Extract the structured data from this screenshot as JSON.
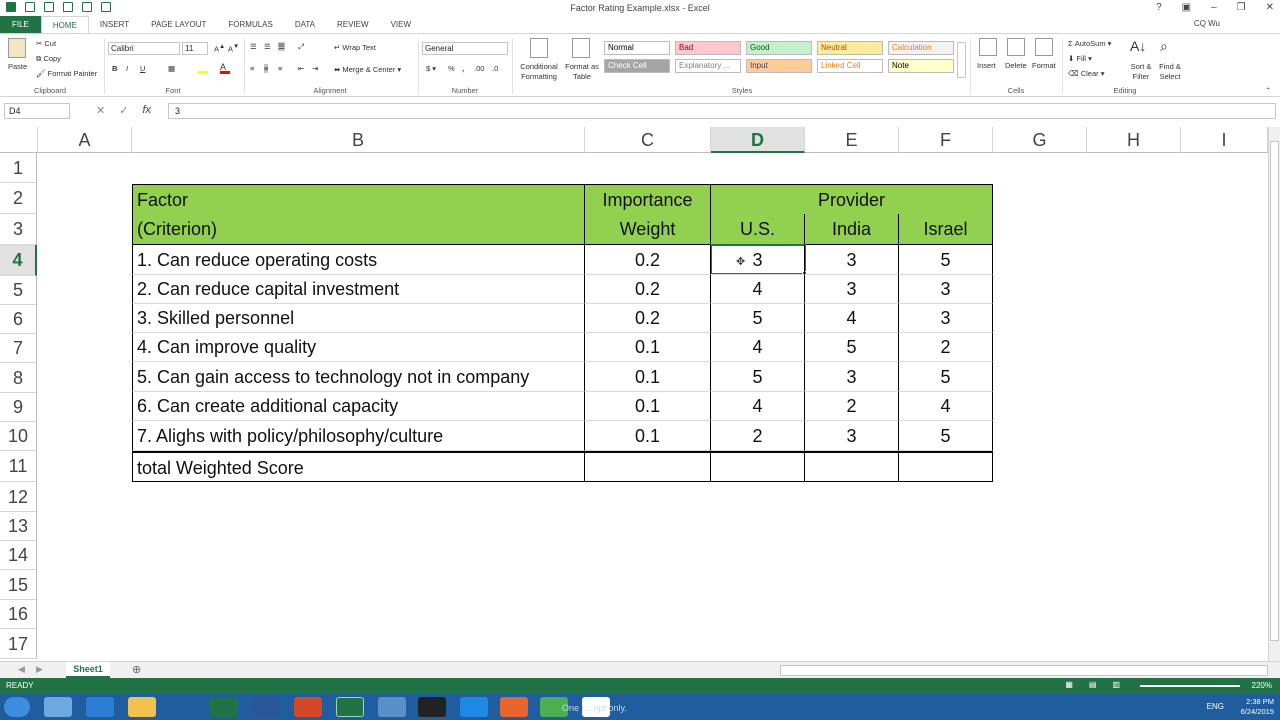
{
  "window": {
    "title": "Factor Rating Example.xlsx - Excel",
    "user": "CQ Wu"
  },
  "tabs": [
    "FILE",
    "HOME",
    "INSERT",
    "PAGE LAYOUT",
    "FORMULAS",
    "DATA",
    "REVIEW",
    "VIEW"
  ],
  "ribbon": {
    "clipboard": {
      "paste": "Paste",
      "cut": "Cut",
      "copy": "Copy",
      "format_painter": "Format Painter",
      "label": "Clipboard"
    },
    "font": {
      "name": "Calibri",
      "size": "11",
      "label": "Font"
    },
    "alignment": {
      "wrap": "Wrap Text",
      "merge": "Merge & Center",
      "label": "Alignment"
    },
    "number": {
      "format": "General",
      "label": "Number"
    },
    "styles": {
      "conditional": "Conditional Formatting",
      "format_table": "Format as Table",
      "cells": [
        {
          "label": "Normal",
          "bg": "#ffffff",
          "fg": "#000000"
        },
        {
          "label": "Bad",
          "bg": "#ffc7ce",
          "fg": "#9c0006"
        },
        {
          "label": "Good",
          "bg": "#c6efce",
          "fg": "#006100"
        },
        {
          "label": "Neutral",
          "bg": "#ffeb9c",
          "fg": "#9c5700"
        },
        {
          "label": "Calculation",
          "bg": "#f2f2f2",
          "fg": "#fa7d00"
        },
        {
          "label": "Check Cell",
          "bg": "#a5a5a5",
          "fg": "#ffffff"
        },
        {
          "label": "Explanatory ...",
          "bg": "#ffffff",
          "fg": "#7f7f7f"
        },
        {
          "label": "Input",
          "bg": "#ffcc99",
          "fg": "#3f3f76"
        },
        {
          "label": "Linked Cell",
          "bg": "#ffffff",
          "fg": "#fa7d00"
        },
        {
          "label": "Note",
          "bg": "#ffffcc",
          "fg": "#000000"
        }
      ],
      "label": "Styles"
    },
    "cells": {
      "insert": "Insert",
      "delete": "Delete",
      "format": "Format",
      "label": "Cells"
    },
    "editing": {
      "autosum": "AutoSum",
      "fill": "Fill",
      "clear": "Clear",
      "sort": "Sort & Filter",
      "find": "Find & Select",
      "label": "Editing"
    }
  },
  "formula_bar": {
    "name_box": "D4",
    "value": "3"
  },
  "columns": [
    "A",
    "B",
    "C",
    "D",
    "E",
    "F",
    "G",
    "H",
    "I"
  ],
  "rows": [
    "1",
    "2",
    "3",
    "4",
    "5",
    "6",
    "7",
    "8",
    "9",
    "10",
    "11",
    "12",
    "13",
    "14",
    "15",
    "16",
    "17"
  ],
  "sheet": {
    "header": {
      "factor": "Factor",
      "criterion": "(Criterion)",
      "importance": "Importance",
      "weight": "Weight",
      "provider": "Provider",
      "us": "U.S.",
      "india": "India",
      "israel": "Israel"
    },
    "factors": [
      {
        "name": "1. Can reduce operating costs",
        "weight": "0.2",
        "us": "3",
        "india": "3",
        "israel": "5"
      },
      {
        "name": "2. Can reduce capital investment",
        "weight": "0.2",
        "us": "4",
        "india": "3",
        "israel": "3"
      },
      {
        "name": "3. Skilled personnel",
        "weight": "0.2",
        "us": "5",
        "india": "4",
        "israel": "3"
      },
      {
        "name": "4. Can improve quality",
        "weight": "0.1",
        "us": "4",
        "india": "5",
        "israel": "2"
      },
      {
        "name": "5. Can gain access to technology not in company",
        "weight": "0.1",
        "us": "5",
        "india": "3",
        "israel": "5"
      },
      {
        "name": "6. Can create additional capacity",
        "weight": "0.1",
        "us": "4",
        "india": "2",
        "israel": "4"
      },
      {
        "name": "7. Alighs with policy/philosophy/culture",
        "weight": "0.1",
        "us": "2",
        "india": "3",
        "israel": "5"
      }
    ],
    "total_label": "total Weighted Score"
  },
  "sheet_tabs": [
    "Sheet1"
  ],
  "status": {
    "mode": "READY",
    "zoom": "220%"
  },
  "taskbar": {
    "tooltip": "One i... npt only.",
    "time": "2:38 PM",
    "date": "6/24/2015",
    "lang": "ENG"
  },
  "colors": {
    "accent": "#217346",
    "header_fill": "#92d050",
    "taskbar": "#1f5d9e"
  }
}
